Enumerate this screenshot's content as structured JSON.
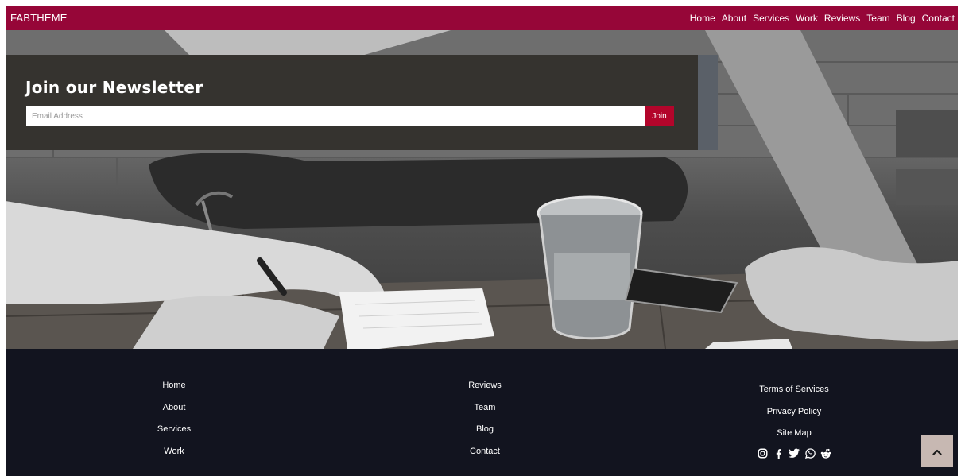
{
  "navbar": {
    "brand": "FABTHEME",
    "links": [
      "Home",
      "About",
      "Services",
      "Work",
      "Reviews",
      "Team",
      "Blog",
      "Contact"
    ]
  },
  "newsletter": {
    "title": "Join our Newsletter",
    "email_placeholder": "Email Address",
    "join_label": "Join"
  },
  "footer": {
    "col1": [
      "Home",
      "About",
      "Services",
      "Work"
    ],
    "col2": [
      "Reviews",
      "Team",
      "Blog",
      "Contact"
    ],
    "col3": [
      "Terms of Services",
      "Privacy Policy",
      "Site Map"
    ],
    "social_icons": [
      "instagram-icon",
      "facebook-icon",
      "twitter-icon",
      "whatsapp-icon",
      "reddit-icon"
    ]
  },
  "colors": {
    "brand": "#960638",
    "join_button": "#b3052b",
    "newsletter_bg": "#35332f",
    "footer_bg": "#12141f",
    "back_to_top_bg": "#c7b8b2"
  },
  "icons": {
    "back_to_top": "chevron-up-icon"
  }
}
